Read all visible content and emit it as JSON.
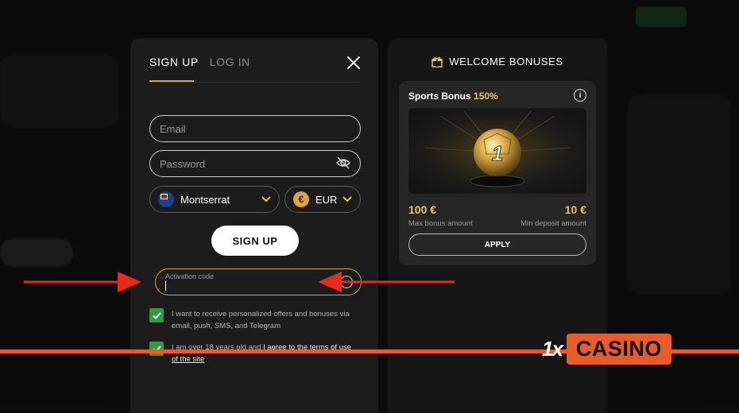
{
  "signup": {
    "tabs": [
      "SIGN UP",
      "LOG IN"
    ],
    "email_placeholder": "Email",
    "password_placeholder": "Password",
    "country": "Montserrat",
    "currency": "EUR",
    "submit_label": "SIGN UP",
    "activation_label": "Activation code",
    "consent_marketing": "I want to receive personalized offers and bonuses via email, push, SMS, and Telegram",
    "consent_age_prefix": "I am over 18 years old and ",
    "consent_age_terms": "I agree to the terms of use",
    "consent_age_site": "of the site"
  },
  "bonuses": {
    "header": "WELCOME BONUSES",
    "card_title": "Sports Bonus ",
    "card_percent": "150%",
    "ball_number": "1",
    "max_amount": "100 €",
    "max_label": "Max bonus amount",
    "min_amount": "10 €",
    "min_label": "Min deposit amount",
    "apply_label": "APPLY"
  },
  "brand": {
    "logo_mark": "1x",
    "logo_text": "CASINO",
    "accent": "#e85c29",
    "gold": "#c9a55a"
  },
  "icons": [
    "close-icon",
    "eye-slash-icon",
    "chevron-down-icon",
    "gift-icon",
    "info-icon",
    "check-icon",
    "arrow-right-icon",
    "arrow-left-icon"
  ]
}
